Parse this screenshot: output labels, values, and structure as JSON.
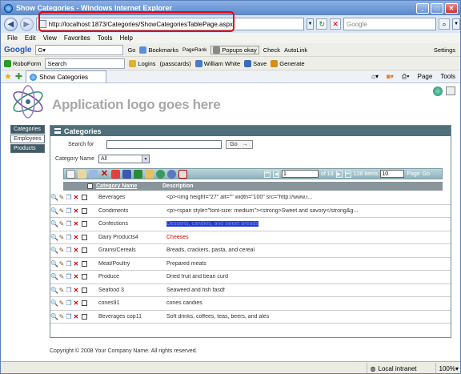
{
  "window": {
    "title": "Show Categories - Windows Internet Explorer"
  },
  "address": {
    "url": "http://localhost:1873/Categories/ShowCategoriesTablePage.aspx",
    "search_placeholder": "Google"
  },
  "menu": [
    "File",
    "Edit",
    "View",
    "Favorites",
    "Tools",
    "Help"
  ],
  "google_bar": {
    "label": "Google",
    "go": "Go",
    "bookmarks": "Bookmarks",
    "pagerank": "PageRank",
    "popups": "Popups okay",
    "check": "Check",
    "autolink": "AutoLink",
    "settings": "Settings"
  },
  "roboform_bar": {
    "label": "RoboForm",
    "search": "Search",
    "logins": "Logins",
    "passcards": "(passcards)",
    "user": "William White",
    "save": "Save",
    "generate": "Generate"
  },
  "fav_bar": {
    "tab_title": "Show Categories",
    "page": "Page",
    "tools": "Tools"
  },
  "app": {
    "logo_text": "Application logo goes here",
    "sidenav": [
      "Categories",
      "Employees",
      "Products"
    ],
    "panel_title": "Categories",
    "search_label": "Search for",
    "go_label": "Go",
    "category_label": "Category Name",
    "category_value": "All",
    "pager": {
      "page": "1",
      "of": "of 13",
      "items": "128 Items",
      "page_size": "10",
      "page_label": "Page",
      "go": "Go"
    },
    "columns": [
      "Category Name",
      "Description"
    ],
    "rows": [
      {
        "name": "Beverages",
        "desc": "<p><img height=\"27\" alt=\"\" width=\"100\" src=\"http://www.i..."
      },
      {
        "name": "Condiments",
        "desc": "<p><span style=\"font-size: medium\"><strong>Sweet and savory</strong&g..."
      },
      {
        "name": "Confections",
        "desc": "Desserts, candies, and sweet breads"
      },
      {
        "name": "Dairy Products4",
        "desc": "Cheeses"
      },
      {
        "name": "Grains/Cereals",
        "desc": "Breads, crackers, pasta, and cereal"
      },
      {
        "name": "Meat/Poultry",
        "desc": "Prepared meats"
      },
      {
        "name": "Produce",
        "desc": "Dried fruit and bean curd"
      },
      {
        "name": "Seafood 3",
        "desc": "Seaweed and fish fasdf"
      },
      {
        "name": "cones91",
        "desc": "cones candies"
      },
      {
        "name": "Beverages cop11",
        "desc": "Soft drinks, coffees, teas, beers, and ales"
      }
    ],
    "footer": "Copyright © 2008 Your Company Name. All rights reserved."
  },
  "status": {
    "zone": "Local intranet",
    "zoom": "100%"
  },
  "colors": {
    "panel_header": "#4f6f7a",
    "highlight_border": "#e00000",
    "selection": "#2438c8"
  }
}
